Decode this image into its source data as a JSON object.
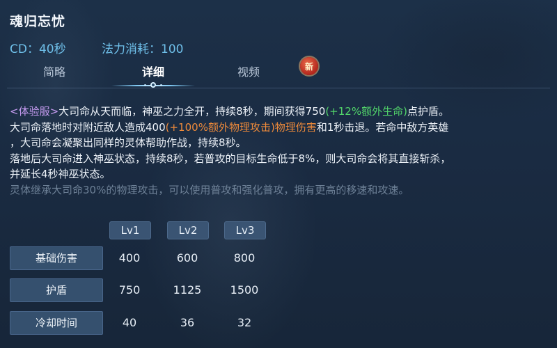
{
  "skill": {
    "name": "魂归忘忧",
    "cd_text": "CD：40秒",
    "mana_text": "法力消耗：100"
  },
  "tabs": {
    "brief": "简略",
    "detail": "详细",
    "video": "视频",
    "new_badge": "新",
    "active": "detail"
  },
  "description": {
    "p1_tag": "<体验服>",
    "p1_a": "大司命从天而临，神巫之力全开，持续8秒，期间获得750",
    "p1_green": "(+12%额外生命)",
    "p1_b": "点护盾。",
    "p2_a": "大司命落地时对附近敌人造成400",
    "p2_orange": "(+100%额外物理攻击)物理伤害",
    "p2_b": "和1秒击退。若命中敌方英雄",
    "p3": "，大司命会凝聚出同样的灵体帮助作战，持续8秒。",
    "p4": "落地后大司命进入神巫状态，持续8秒，若普攻的目标生命低于8%，则大司命会将其直接斩杀，",
    "p5": "并延长4秒神巫状态。",
    "p6": "灵体继承大司命30%的物理攻击，可以使用普攻和强化普攻，拥有更高的移速和攻速。"
  },
  "table": {
    "levels": [
      "Lv1",
      "Lv2",
      "Lv3"
    ],
    "rows": [
      {
        "label": "基础伤害",
        "values": [
          "400",
          "600",
          "800"
        ]
      },
      {
        "label": "护盾",
        "values": [
          "750",
          "1125",
          "1500"
        ]
      },
      {
        "label": "冷却时间",
        "values": [
          "40",
          "36",
          "32"
        ]
      }
    ]
  },
  "colors": {
    "accent": "#6fc0ea",
    "tag": "#c59bf0",
    "bonus_hp": "#52d56a",
    "bonus_atk": "#ee8a3a"
  }
}
